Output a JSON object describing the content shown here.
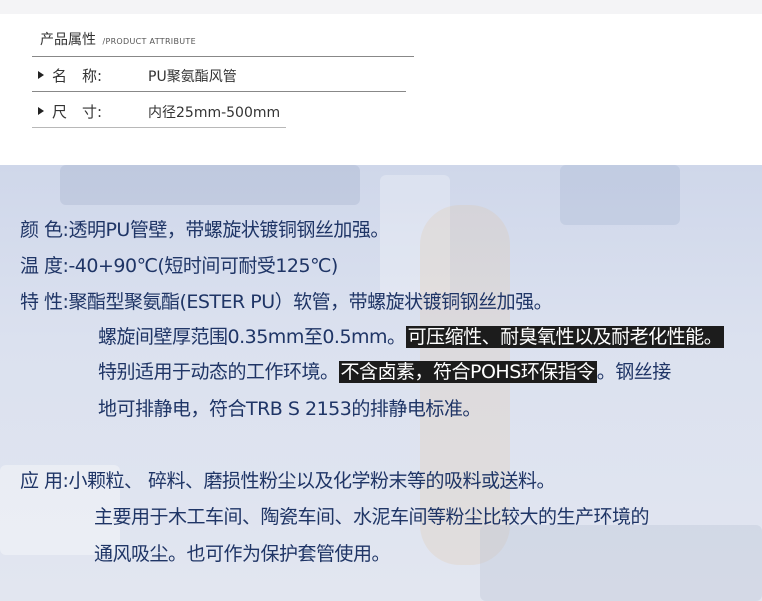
{
  "attributes": {
    "title": "产品属性",
    "title_en": "/PRODUCT ATTRIBUTE",
    "rows": [
      {
        "key": "名　称:",
        "value": "PU聚氨酯风管"
      },
      {
        "key": "尺　寸:",
        "value": "内径25mm-500mm"
      }
    ]
  },
  "specs": {
    "color_label": "颜 色:",
    "color_text": "透明PU管壁，带螺旋状镀铜钢丝加强。",
    "temp_label": "温 度:",
    "temp_text": "-40+90℃(短时间可耐受125℃)",
    "feature_label": "特 性:",
    "feature_line1": "聚酯型聚氨酯(ESTER PU）软管，带螺旋状镀铜钢丝加强。",
    "feature_line2_plain": "螺旋间壁厚范围0.35mm至0.5mm。",
    "feature_line2_highlight": "可压缩性、耐臭氧性以及耐老化性能。",
    "feature_line3_plain": "特别适用于动态的工作环境。",
    "feature_line3_highlight": "不含卤素，符合POHS环保指令",
    "feature_line3_tail": "。钢丝接",
    "feature_line4": "地可排静电，符合TRB S 2153的排静电标准。",
    "usage_label": "应 用:",
    "usage_line1": "小颗粒、 碎料、磨损性粉尘以及化学粉末等的吸料或送料。",
    "usage_line2": "主要用于木工车间、陶瓷车间、水泥车间等粉尘比较大的生产环境的",
    "usage_line3": "通风吸尘。也可作为保护套管使用。"
  },
  "colors": {
    "text_blue": "#1f3566",
    "highlight_bg": "#1c1c1c",
    "panel_bg": "#d8dfee"
  }
}
